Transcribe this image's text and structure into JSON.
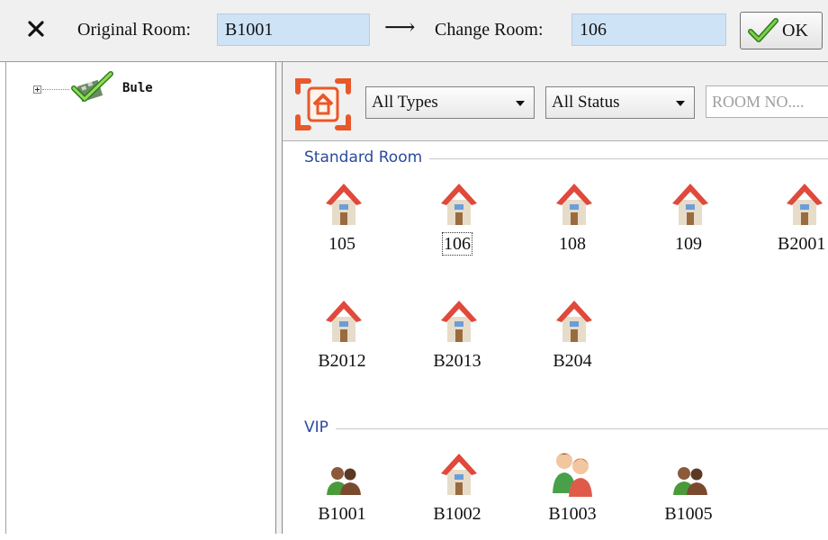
{
  "topbar": {
    "original_room_label": "Original Room:",
    "original_room_value": "B1001",
    "arrow": "⟶",
    "change_room_label": "Change Room:",
    "change_room_value": "106",
    "ok_label": "OK"
  },
  "tree": {
    "node_label": "Bule"
  },
  "filters": {
    "type_selected": "All Types",
    "status_selected": "All Status",
    "search_placeholder": "ROOM NO...."
  },
  "groups": [
    {
      "title": "Standard Room",
      "rooms": [
        {
          "number": "105",
          "icon": "house-icon"
        },
        {
          "number": "106",
          "icon": "house-icon",
          "focused": true
        },
        {
          "number": "108",
          "icon": "house-icon"
        },
        {
          "number": "109",
          "icon": "house-icon"
        },
        {
          "number": "B2001",
          "icon": "house-icon"
        },
        {
          "number": "B2012",
          "icon": "house-icon"
        },
        {
          "number": "B2013",
          "icon": "house-icon"
        },
        {
          "number": "B204",
          "icon": "house-icon"
        }
      ]
    },
    {
      "title": "VIP",
      "rooms": [
        {
          "number": "B1001",
          "icon": "guests-icon"
        },
        {
          "number": "B1002",
          "icon": "house-icon"
        },
        {
          "number": "B1003",
          "icon": "guests-large-icon"
        },
        {
          "number": "B1005",
          "icon": "guests-icon"
        }
      ]
    }
  ],
  "colors": {
    "field_bg": "#cfe3f7",
    "group_title": "#2a4aa0",
    "accent_orange": "#e8582a"
  }
}
